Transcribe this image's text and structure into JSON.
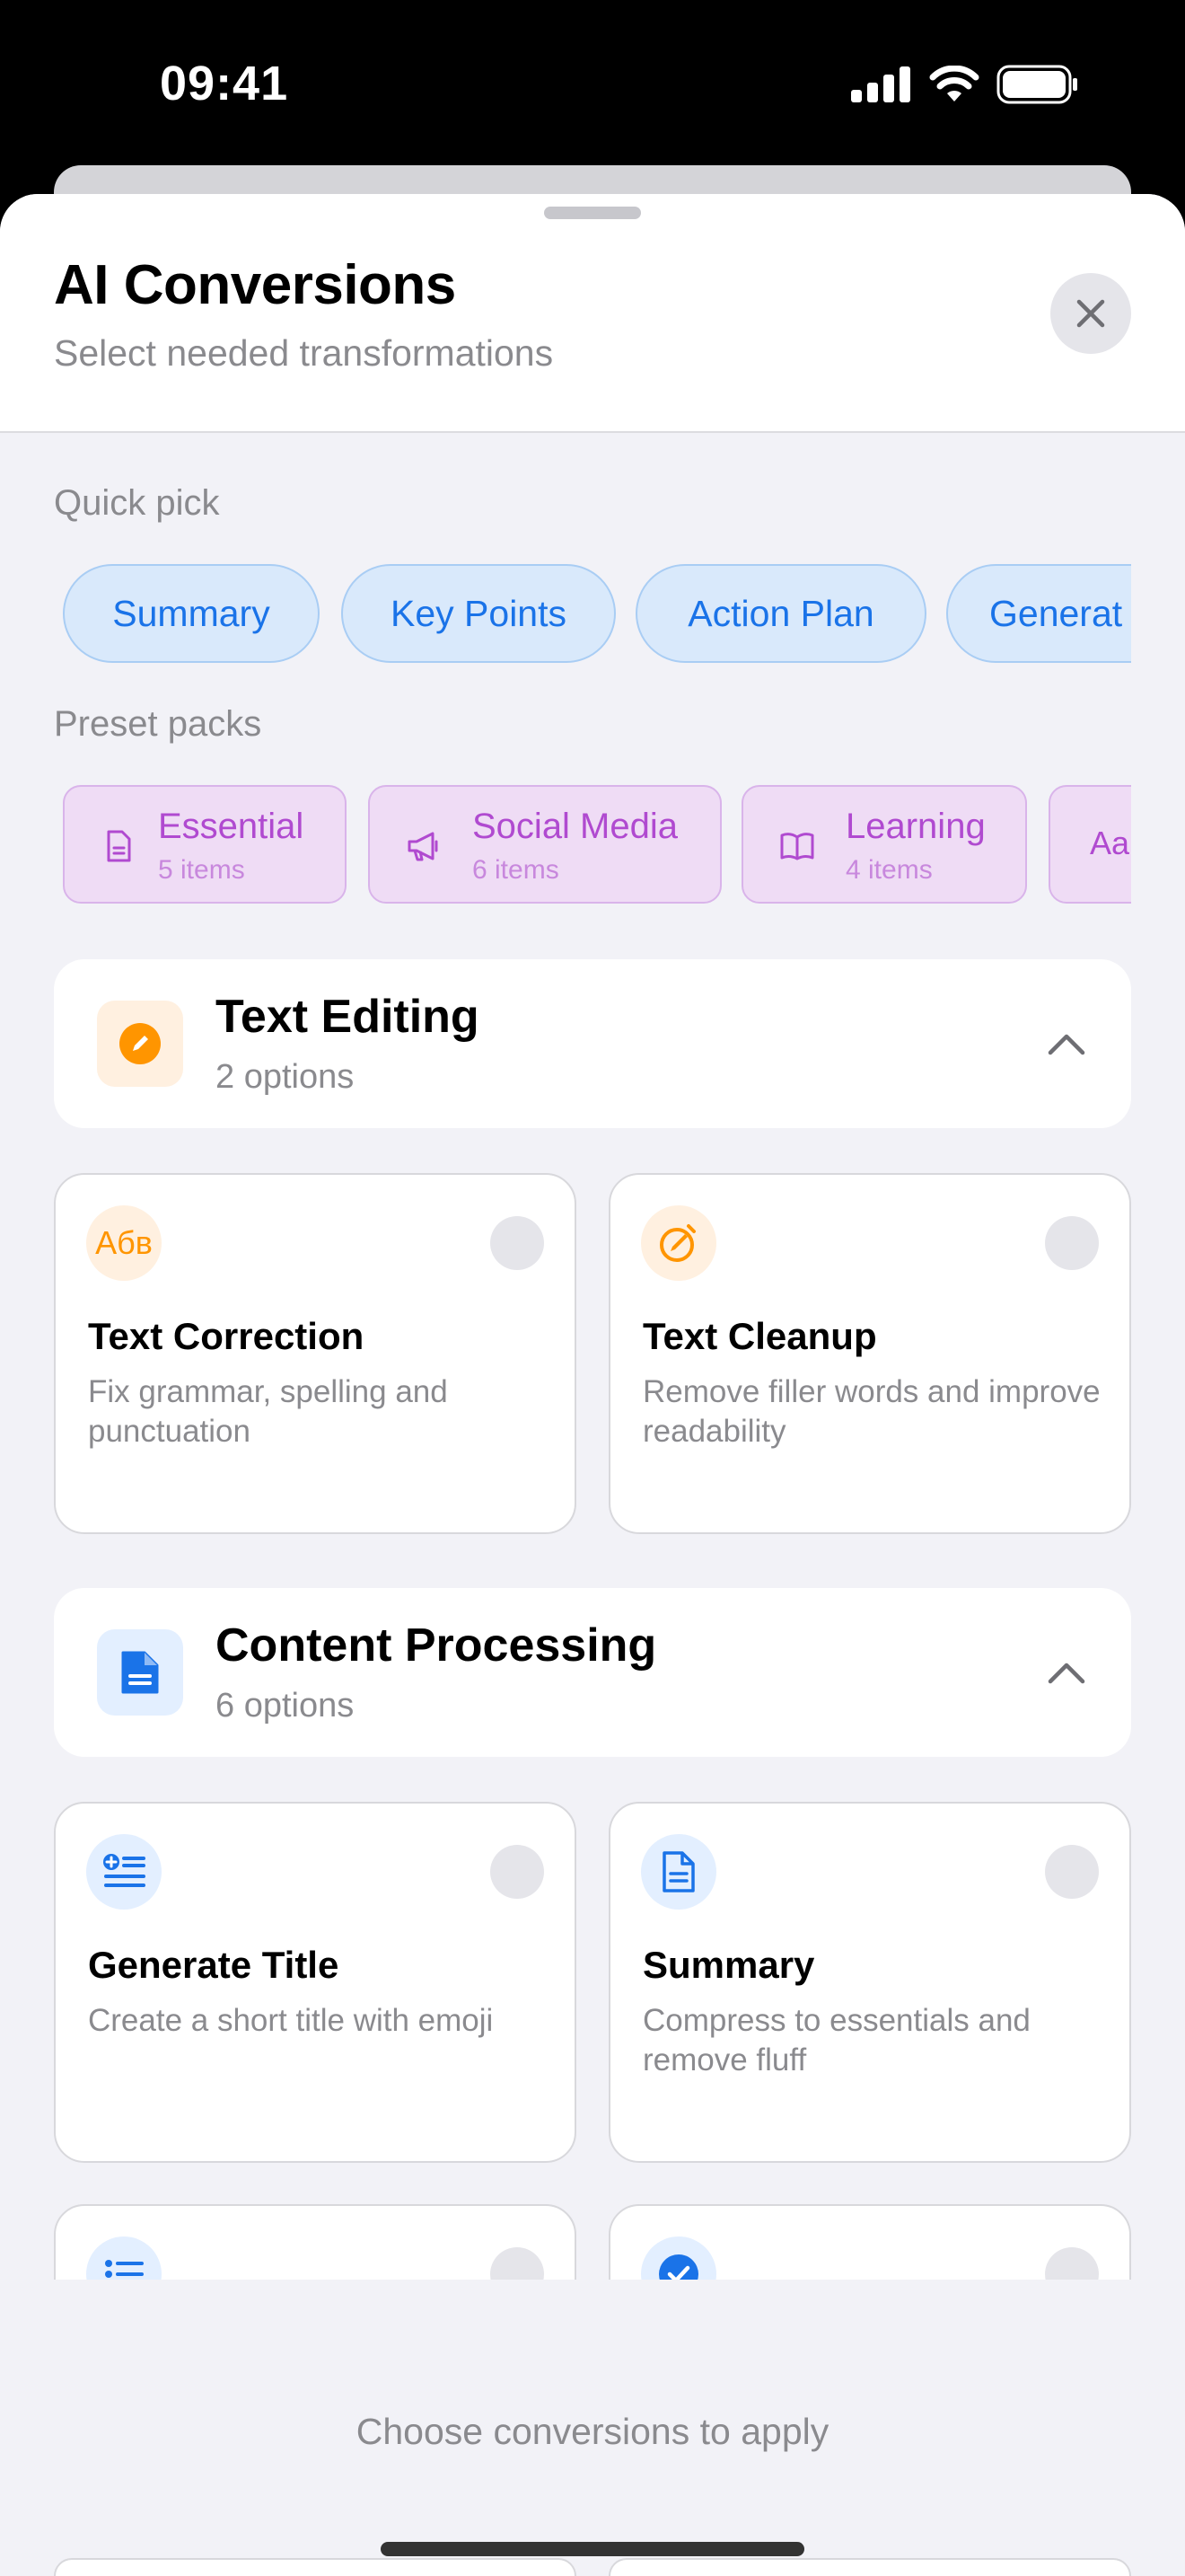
{
  "status_bar": {
    "time": "09:41"
  },
  "header": {
    "title": "AI Conversions",
    "subtitle": "Select needed transformations",
    "close_icon": "close-icon"
  },
  "quick_pick": {
    "label": "Quick pick",
    "chips": [
      "Summary",
      "Key Points",
      "Action Plan",
      "Generat"
    ]
  },
  "preset_packs": {
    "label": "Preset packs",
    "packs": [
      {
        "name": "Essential",
        "count": "5 items",
        "icon": "document-icon"
      },
      {
        "name": "Social Media",
        "count": "6 items",
        "icon": "megaphone-icon"
      },
      {
        "name": "Learning",
        "count": "4 items",
        "icon": "book-icon"
      },
      {
        "name": "Aa",
        "count": "",
        "icon": ""
      }
    ]
  },
  "categories": [
    {
      "title": "Text Editing",
      "count": "2 options",
      "icon": "pencil-icon",
      "accent": "#ff9500",
      "options": [
        {
          "title": "Text Correction",
          "desc": "Fix grammar, spelling and punctuation",
          "icon_text": "Абв",
          "icon": "spellcheck-icon"
        },
        {
          "title": "Text Cleanup",
          "desc": "Remove filler words and improve readability",
          "icon": "cleanup-icon"
        }
      ]
    },
    {
      "title": "Content Processing",
      "count": "6 options",
      "icon": "document-icon",
      "accent": "#1a73e8",
      "options": [
        {
          "title": "Generate Title",
          "desc": "Create a short title with emoji",
          "icon": "title-list-icon"
        },
        {
          "title": "Summary",
          "desc": "Compress to essentials and remove fluff",
          "icon": "document-icon"
        }
      ]
    }
  ],
  "footer": {
    "hint": "Choose conversions to apply"
  },
  "colors": {
    "blue": "#1a73e8",
    "orange": "#ff9500",
    "purple": "#b04ad0"
  }
}
